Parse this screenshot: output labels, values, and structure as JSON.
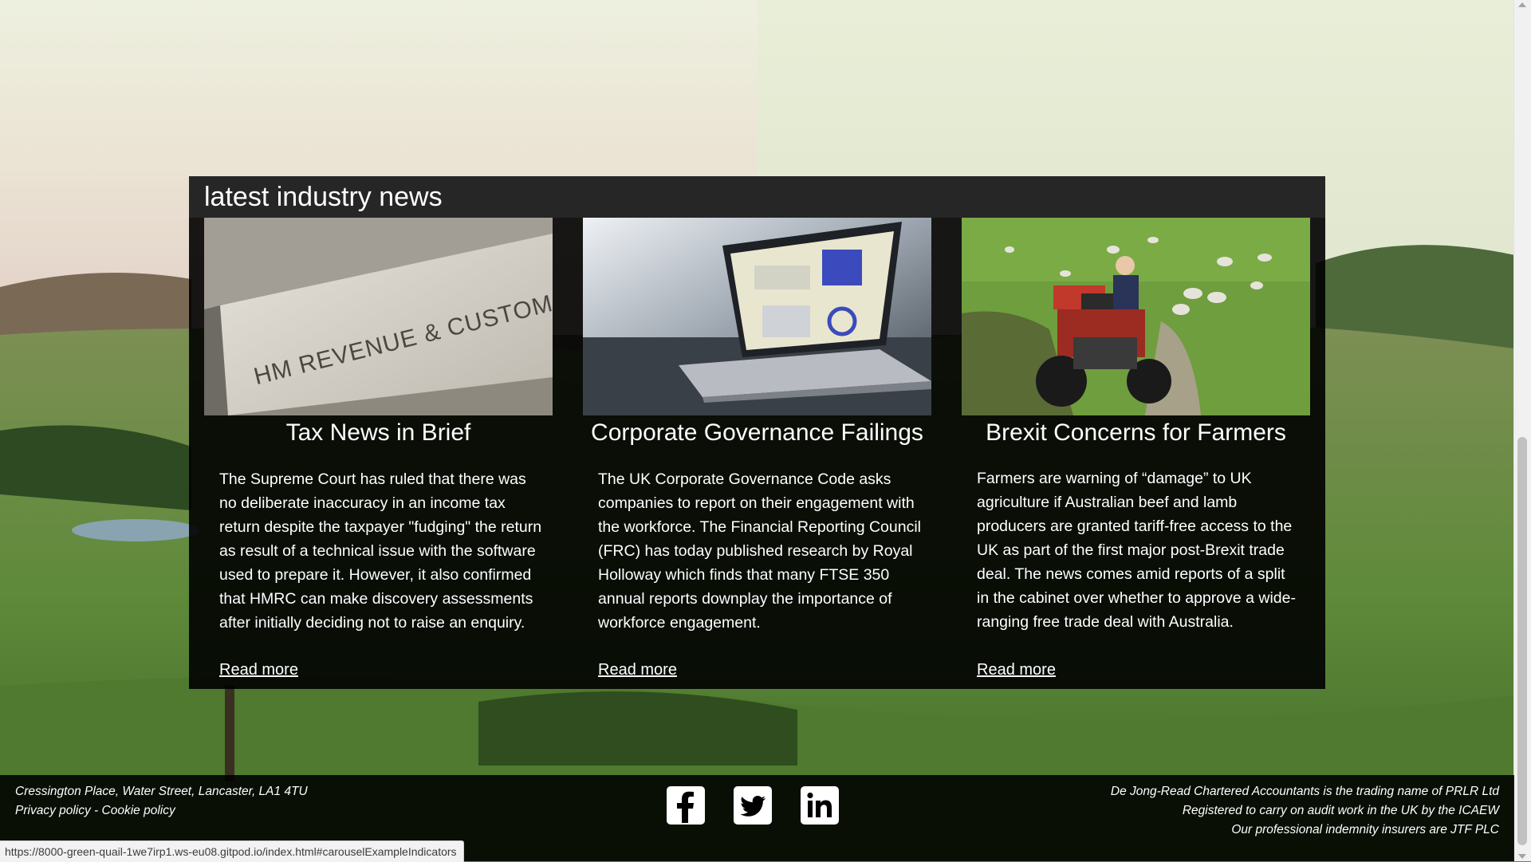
{
  "news": {
    "heading": "latest industry news",
    "articles": [
      {
        "title": "Tax News in Brief",
        "sign_text": "HM REVENUE & CUSTOMS",
        "body": "The Supreme Court has ruled that there was no deliberate inaccuracy in an income tax return despite the taxpayer \"fudging\" the return as result of a technical issue with the software used to prepare it. However, it also confirmed that HMRC can make discovery assessments after initially deciding not to raise an enquiry.",
        "link": "Read more"
      },
      {
        "title": "Corporate Governance Failings",
        "body": "The UK Corporate Governance Code asks companies to report on their engagement with the workforce. The Financial Reporting Council (FRC) has today published research by Royal Holloway which finds that many FTSE 350 annual reports downplay the importance of workforce engagement.",
        "link": "Read more"
      },
      {
        "title": "Brexit Concerns for Farmers",
        "body": "Farmers are warning of “damage” to UK agriculture if Australian beef and lamb producers are granted tariff-free access to the UK as part of the first major post-Brexit trade deal. The news comes amid reports of a split in the cabinet over whether to approve a wide-ranging free trade deal with Australia.",
        "link": "Read more"
      }
    ]
  },
  "footer": {
    "address": "Cressington Place, Water Street, Lancaster, LA1 4TU",
    "privacy": "Privacy policy",
    "separator": " - ",
    "cookie": "Cookie policy",
    "social": [
      "facebook-icon",
      "twitter-icon",
      "linkedin-icon"
    ],
    "legal": [
      "De Jong-Read Chartered Accountants is the trading name of PRLR Ltd",
      "Registered to carry on audit work in the UK by the ICAEW",
      "Our professional indemnity insurers are JTF PLC"
    ]
  },
  "status_url": "https://8000-green-quail-1we7irp1.ws-eu08.gitpod.io/index.html#carouselExampleIndicators",
  "colors": {
    "panel": "#000000",
    "header": "#282828",
    "text": "#ffffff",
    "grass": "#5f8a3a",
    "sky": "#e8ead6"
  }
}
